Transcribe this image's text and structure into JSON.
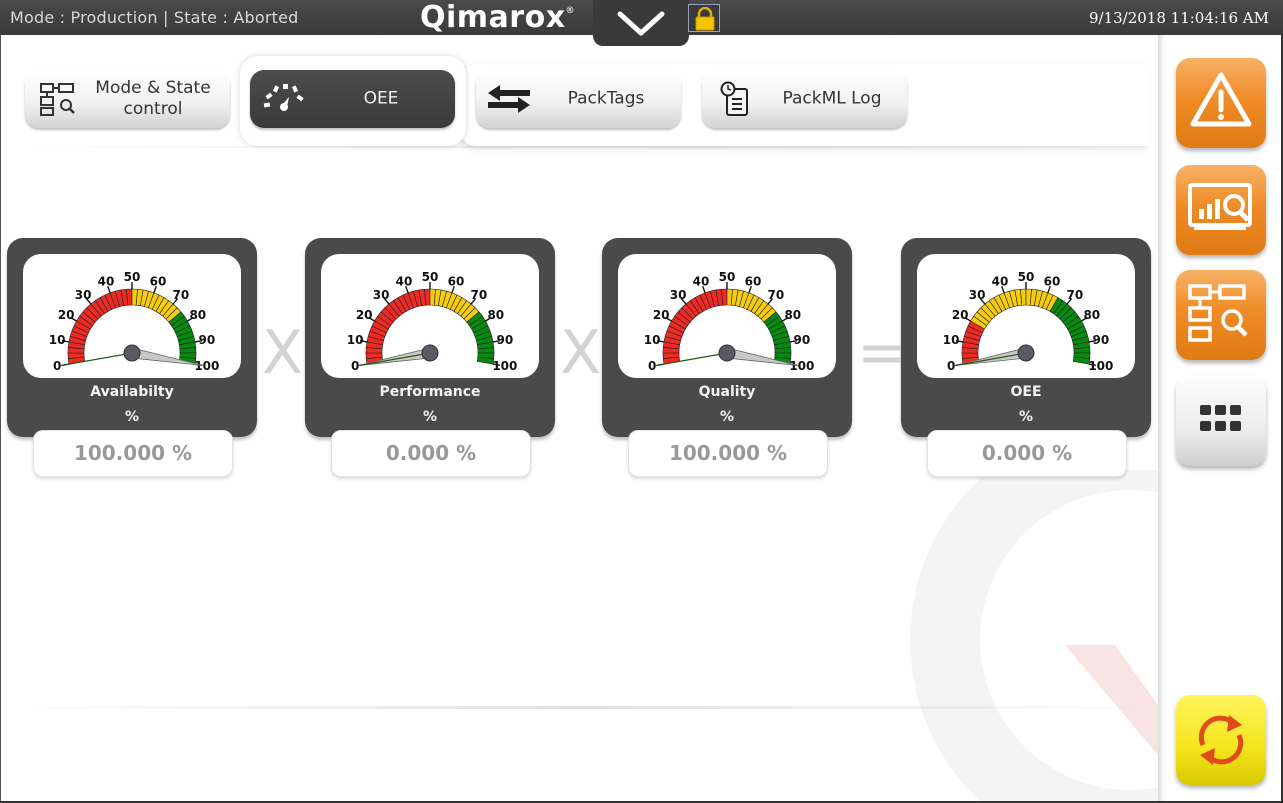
{
  "header": {
    "status_text": "Mode : Production | State : Aborted",
    "logo_text": "Qimarox",
    "logo_mark": "®",
    "datetime": "9/13/2018 11:04:16 AM"
  },
  "tabs": [
    {
      "id": "mode-state",
      "label_line1": "Mode & State",
      "label_line2": "control",
      "icon": "mode-state-icon",
      "active": false
    },
    {
      "id": "oee",
      "label": "OEE",
      "icon": "speedometer-icon",
      "active": true
    },
    {
      "id": "packtags",
      "label": "PackTags",
      "icon": "arrows-exchange-icon",
      "active": false
    },
    {
      "id": "packml-log",
      "label": "PackML Log",
      "icon": "clock-document-icon",
      "active": false
    }
  ],
  "gauges": [
    {
      "title": "Availabilty",
      "unit": "%",
      "value_text": "100.000 %",
      "value": 100,
      "zones": {
        "red": [
          0,
          50
        ],
        "yellow": [
          50,
          75
        ],
        "green": [
          75,
          100
        ]
      }
    },
    {
      "title": "Performance",
      "unit": "%",
      "value_text": "0.000 %",
      "value": 0,
      "zones": {
        "red": [
          0,
          50
        ],
        "yellow": [
          50,
          75
        ],
        "green": [
          75,
          100
        ]
      }
    },
    {
      "title": "Quality",
      "unit": "%",
      "value_text": "100.000 %",
      "value": 100,
      "zones": {
        "red": [
          0,
          50
        ],
        "yellow": [
          50,
          75
        ],
        "green": [
          75,
          100
        ]
      }
    },
    {
      "title": "OEE",
      "unit": "%",
      "value_text": "0.000 %",
      "value": 0,
      "zones": {
        "red": [
          0,
          20
        ],
        "yellow": [
          20,
          65
        ],
        "green": [
          65,
          100
        ]
      }
    }
  ],
  "gauge_ticks": [
    "0",
    "10",
    "20",
    "30",
    "40",
    "50",
    "60",
    "70",
    "80",
    "90",
    "100"
  ],
  "operators": [
    "X",
    "X",
    "="
  ],
  "sidebar_buttons": [
    {
      "icon": "warning-icon",
      "color": "orange"
    },
    {
      "icon": "monitor-analytics-icon",
      "color": "orange"
    },
    {
      "icon": "flowchart-search-icon",
      "color": "orange"
    },
    {
      "icon": "grid-menu-icon",
      "color": "gray"
    },
    {
      "icon": "refresh-icon",
      "color": "yellow"
    }
  ],
  "colors": {
    "red": "#ee2a24",
    "yellow": "#f7cc0f",
    "green": "#078a10",
    "orange": "#ef8c27",
    "dark": "#4a4a4a"
  }
}
